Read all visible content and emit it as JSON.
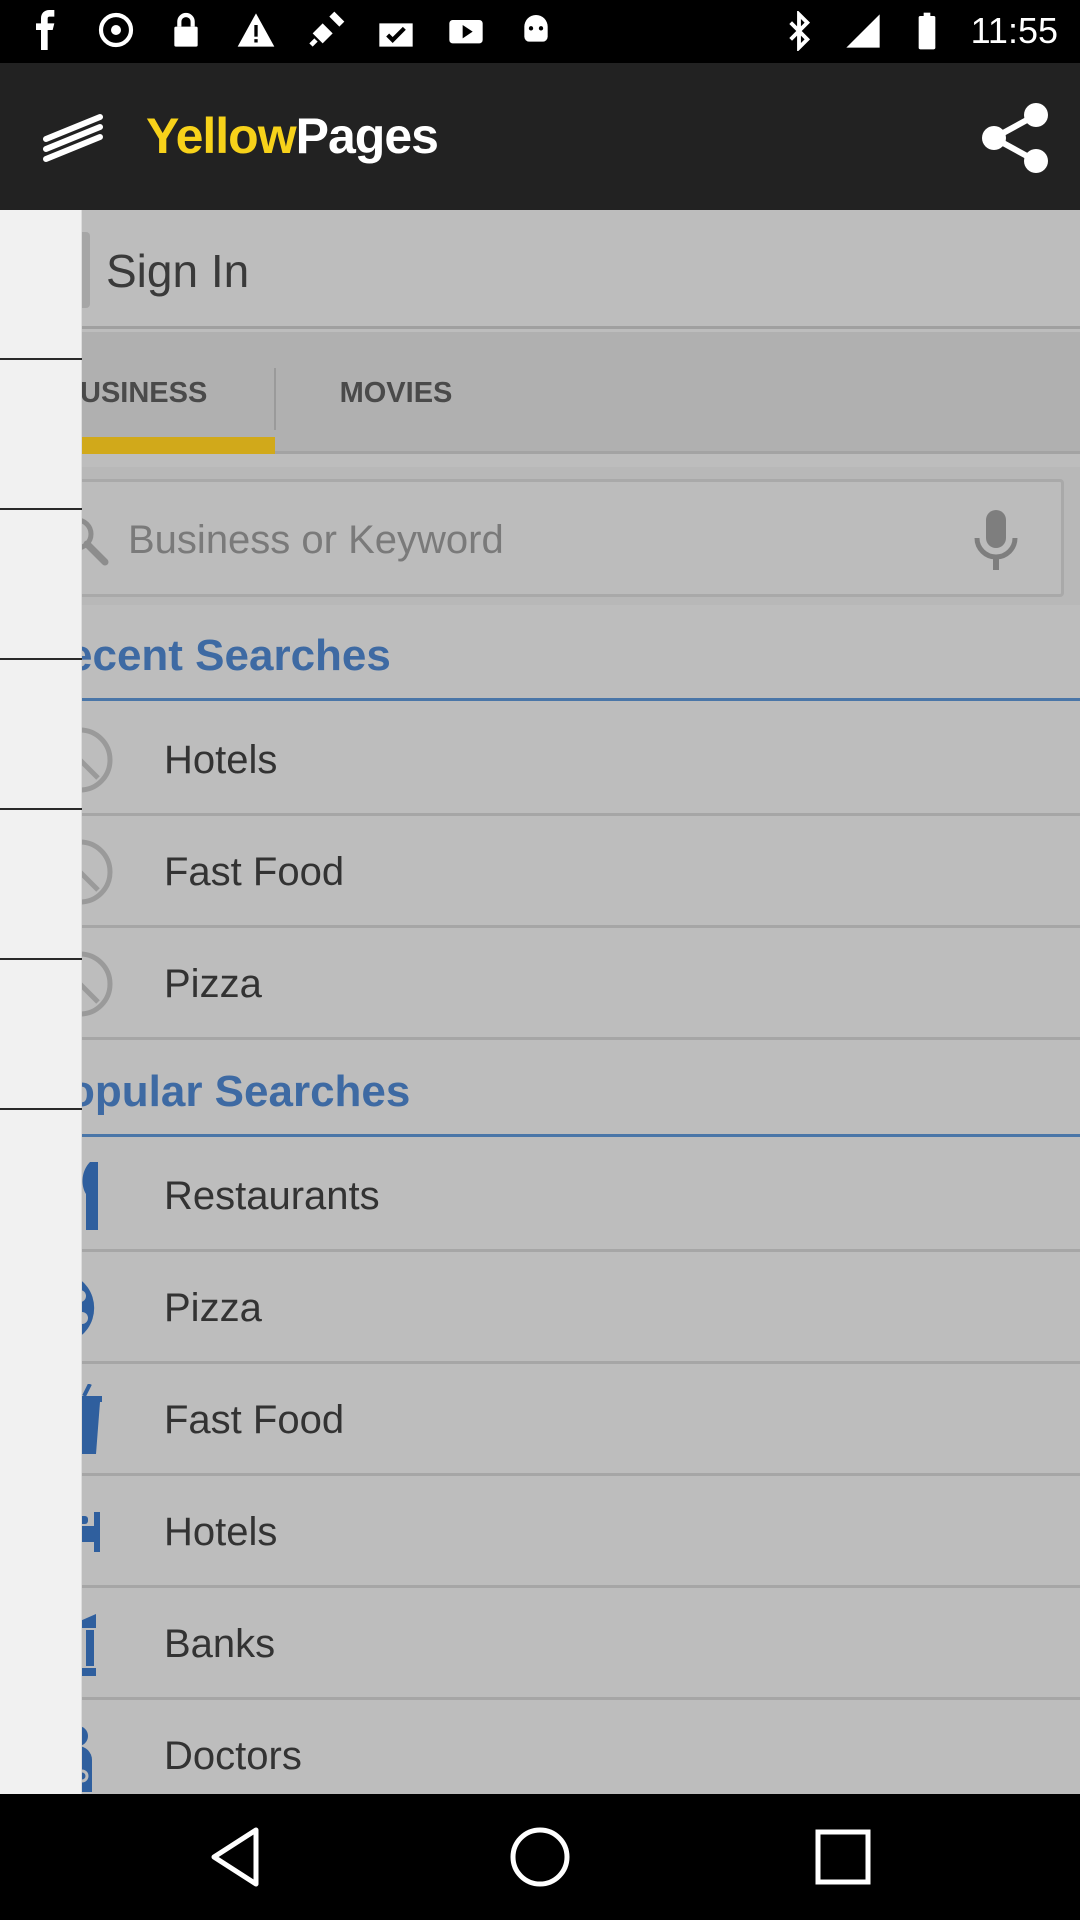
{
  "status_bar": {
    "time": "11:55",
    "left_icons": [
      "facebook-icon",
      "sync-icon",
      "lock-icon",
      "warning-icon",
      "satellite-icon",
      "photo-check-icon",
      "play-store-icon",
      "android-icon"
    ],
    "right_icons": [
      "bluetooth-icon",
      "signal-icon",
      "battery-icon"
    ]
  },
  "app_bar": {
    "logo_yellow": "Yellow",
    "logo_pages": "Pages",
    "menu_icon": "menu-icon",
    "share_icon": "share-icon"
  },
  "sign_in": {
    "label": "Sign In"
  },
  "tabs": [
    {
      "label": "USINESS",
      "active": true
    },
    {
      "label": "MOVIES",
      "active": false
    }
  ],
  "search": {
    "placeholder": "Business or Keyword"
  },
  "recent": {
    "header": "ecent Searches",
    "items": [
      {
        "label": "Hotels",
        "icon": "history-icon"
      },
      {
        "label": "Fast Food",
        "icon": "history-icon"
      },
      {
        "label": "Pizza",
        "icon": "history-icon"
      }
    ]
  },
  "popular": {
    "header": "opular Searches",
    "items": [
      {
        "label": "Restaurants",
        "icon": "restaurant-icon"
      },
      {
        "label": "Pizza",
        "icon": "pizza-icon"
      },
      {
        "label": "Fast Food",
        "icon": "drink-cup-icon"
      },
      {
        "label": "Hotels",
        "icon": "bed-icon"
      },
      {
        "label": "Banks",
        "icon": "bank-icon"
      },
      {
        "label": "Doctors",
        "icon": "doctor-icon"
      }
    ]
  },
  "colors": {
    "accent_yellow": "#f7d21a",
    "section_blue": "#3e6aa3",
    "tab_underline": "#d1a91a"
  },
  "nav_bar": {
    "icons": [
      "back-icon",
      "home-icon",
      "recents-icon"
    ]
  }
}
